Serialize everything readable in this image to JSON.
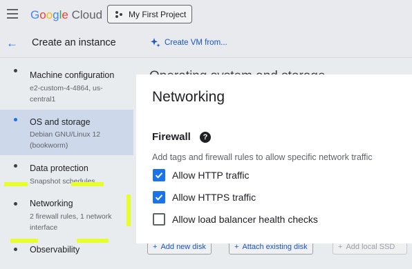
{
  "header": {
    "brand": "Google Cloud",
    "project": "My First Project"
  },
  "subheader": {
    "title": "Create an instance",
    "create_vm": "Create VM from..."
  },
  "sidebar": {
    "items": [
      {
        "title": "Machine configuration",
        "subtitle": "e2-custom-4-4864, us-central1",
        "active": false
      },
      {
        "title": "OS and storage",
        "subtitle": "Debian GNU/Linux 12 (bookworm)",
        "active": true
      },
      {
        "title": "Data protection",
        "subtitle": "Snapshot schedules",
        "active": false
      },
      {
        "title": "Networking",
        "subtitle": "2 firewall rules, 1 network interface",
        "active": false
      },
      {
        "title": "Observability",
        "subtitle": "",
        "active": false
      }
    ]
  },
  "main": {
    "background_heading": "Operating system and storage",
    "disk_buttons": [
      "Add new disk",
      "Attach existing disk",
      "Add local SSD"
    ]
  },
  "modal": {
    "title": "Networking",
    "firewall_title": "Firewall",
    "firewall_desc": "Add tags and firewall rules to allow specific network traffic",
    "options": [
      {
        "label": "Allow HTTP traffic",
        "checked": true
      },
      {
        "label": "Allow HTTPS traffic",
        "checked": true
      },
      {
        "label": "Allow load balancer health checks",
        "checked": false
      }
    ]
  },
  "colors": {
    "accent": "#1a73e8",
    "highlight": "#e6ff2a",
    "active_nav": "#cdd8ea"
  }
}
